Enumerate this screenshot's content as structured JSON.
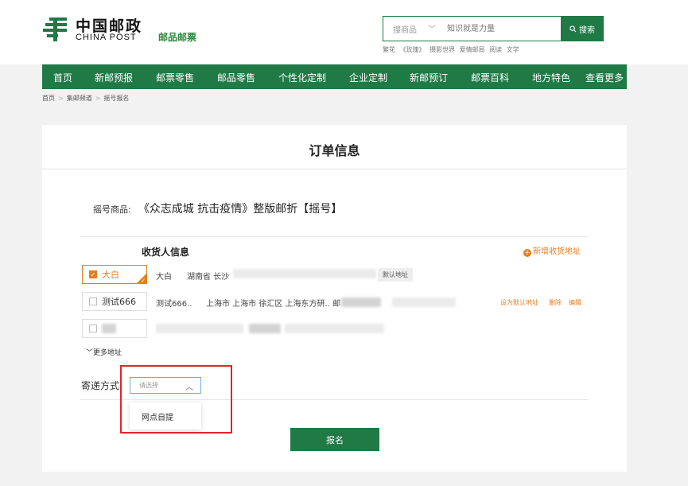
{
  "header": {
    "logo_cn": "中国邮政",
    "logo_en": "CHINA POST",
    "site_subtitle": "邮品邮票",
    "search": {
      "category": "搜商品",
      "placeholder": "知识就是力量",
      "button_label": "搜索"
    },
    "hot_words": [
      "繁花",
      "《玫瑰》",
      "摄影世界",
      "爱情邮局",
      "阅读",
      "文学"
    ]
  },
  "nav": {
    "items": [
      "首页",
      "新邮预报",
      "邮票零售",
      "邮品零售",
      "个性化定制",
      "企业定制",
      "新邮预订",
      "邮票百科",
      "地方特色",
      "查看更多"
    ]
  },
  "breadcrumb": [
    "首页",
    "集邮频道",
    "摇号报名"
  ],
  "order": {
    "title": "订单信息",
    "product_label": "摇号商品:",
    "product_name": "《众志成城 抗击疫情》整版邮折【摇号】",
    "receiver_title": "收货人信息",
    "add_address_label": "新增收货地址",
    "addresses": [
      {
        "name": "大白",
        "recipient": "大白",
        "address": "湖南省 长沙",
        "tag": "默认地址",
        "selected": true
      },
      {
        "name": "测试666",
        "recipient": "测试666..",
        "address": "上海市 上海市 徐汇区 上海东方研.. 邮",
        "actions": [
          "设为默认地址",
          "删除",
          "编辑"
        ],
        "selected": false
      },
      {
        "name": "",
        "recipient": "",
        "address": "",
        "selected": false
      }
    ],
    "more_addresses_label": "更多地址",
    "shipping": {
      "label": "寄递方式:",
      "placeholder": "请选择",
      "options": [
        "网点自提"
      ]
    },
    "submit_label": "报名"
  },
  "colors": {
    "brand_green": "#1f7a45",
    "accent_orange": "#e67e22",
    "highlight_red": "#e8212e"
  }
}
